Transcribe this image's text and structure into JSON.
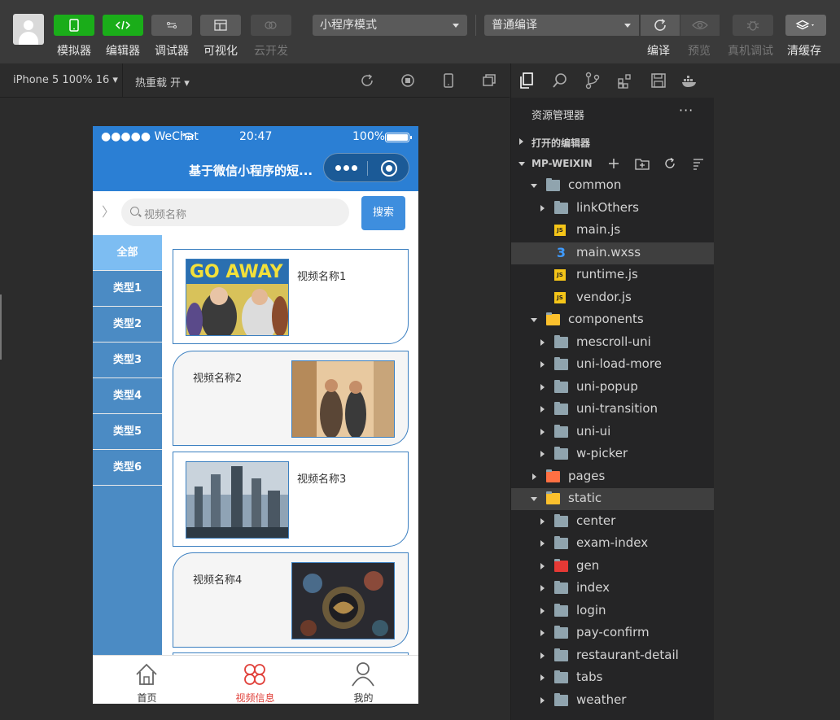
{
  "toolbar": {
    "tools": [
      {
        "label": "模拟器",
        "icon": "phone-icon"
      },
      {
        "label": "编辑器",
        "icon": "code-icon"
      },
      {
        "label": "调试器",
        "icon": "debugger-icon"
      },
      {
        "label": "可视化",
        "icon": "layout-icon"
      },
      {
        "label": "云开发",
        "icon": "cloud-icon"
      }
    ],
    "mode_select": "小程序模式",
    "compile_select": "普通编译",
    "compile_label": "编译",
    "preview_label": "预览",
    "remote_debug_label": "真机调试",
    "clear_cache_label": "清缓存"
  },
  "simbar": {
    "device": "iPhone 5 100% 16",
    "hot_reload": "热重载 开"
  },
  "phone": {
    "status": {
      "carrier": "●●●●● WeChat",
      "time": "20:47",
      "battery": "100%"
    },
    "nav_title": "基于微信小程序的短...",
    "search": {
      "placeholder": "视频名称",
      "button": "搜索"
    },
    "categories": [
      "全部",
      "类型1",
      "类型2",
      "类型3",
      "类型4",
      "类型5",
      "类型6"
    ],
    "active_category": 0,
    "videos": [
      {
        "name": "视频名称1"
      },
      {
        "name": "视频名称2"
      },
      {
        "name": "视频名称3"
      },
      {
        "name": "视频名称4"
      }
    ],
    "tabs": [
      {
        "label": "首页",
        "icon": "home-icon"
      },
      {
        "label": "视频信息",
        "icon": "video-info-icon"
      },
      {
        "label": "我的",
        "icon": "user-icon"
      }
    ],
    "active_tab": 1
  },
  "explorer": {
    "title": "资源管理器",
    "more": "···",
    "open_editors": "打开的编辑器",
    "project": "MP-WEIXIN",
    "tree": [
      {
        "name": "common",
        "expanded": true,
        "depth": 0,
        "type": "folder-open"
      },
      {
        "name": "linkOthers",
        "depth": 1,
        "type": "folder"
      },
      {
        "name": "main.js",
        "depth": 1,
        "type": "js"
      },
      {
        "name": "main.wxss",
        "depth": 1,
        "type": "css",
        "selected": true
      },
      {
        "name": "runtime.js",
        "depth": 1,
        "type": "js"
      },
      {
        "name": "vendor.js",
        "depth": 1,
        "type": "js"
      },
      {
        "name": "components",
        "expanded": true,
        "depth": 0,
        "type": "folder-components"
      },
      {
        "name": "mescroll-uni",
        "depth": 1,
        "type": "folder"
      },
      {
        "name": "uni-load-more",
        "depth": 1,
        "type": "folder"
      },
      {
        "name": "uni-popup",
        "depth": 1,
        "type": "folder"
      },
      {
        "name": "uni-transition",
        "depth": 1,
        "type": "folder"
      },
      {
        "name": "uni-ui",
        "depth": 1,
        "type": "folder"
      },
      {
        "name": "w-picker",
        "depth": 1,
        "type": "folder"
      },
      {
        "name": "pages",
        "depth": 0,
        "type": "folder-pages"
      },
      {
        "name": "static",
        "expanded": true,
        "depth": 0,
        "type": "folder-static",
        "selected": true
      },
      {
        "name": "center",
        "depth": 1,
        "type": "folder"
      },
      {
        "name": "exam-index",
        "depth": 1,
        "type": "folder"
      },
      {
        "name": "gen",
        "depth": 1,
        "type": "folder-gen"
      },
      {
        "name": "index",
        "depth": 1,
        "type": "folder"
      },
      {
        "name": "login",
        "depth": 1,
        "type": "folder"
      },
      {
        "name": "pay-confirm",
        "depth": 1,
        "type": "folder"
      },
      {
        "name": "restaurant-detail",
        "depth": 1,
        "type": "folder"
      },
      {
        "name": "tabs",
        "depth": 1,
        "type": "folder"
      },
      {
        "name": "weather",
        "depth": 1,
        "type": "folder"
      }
    ]
  },
  "colors": {
    "accent": "#1aad19",
    "nav_blue": "#2b7fd4",
    "category_bg": "#4b8bc4",
    "category_active": "#7dbdf2",
    "active_tab": "#e0403a"
  }
}
